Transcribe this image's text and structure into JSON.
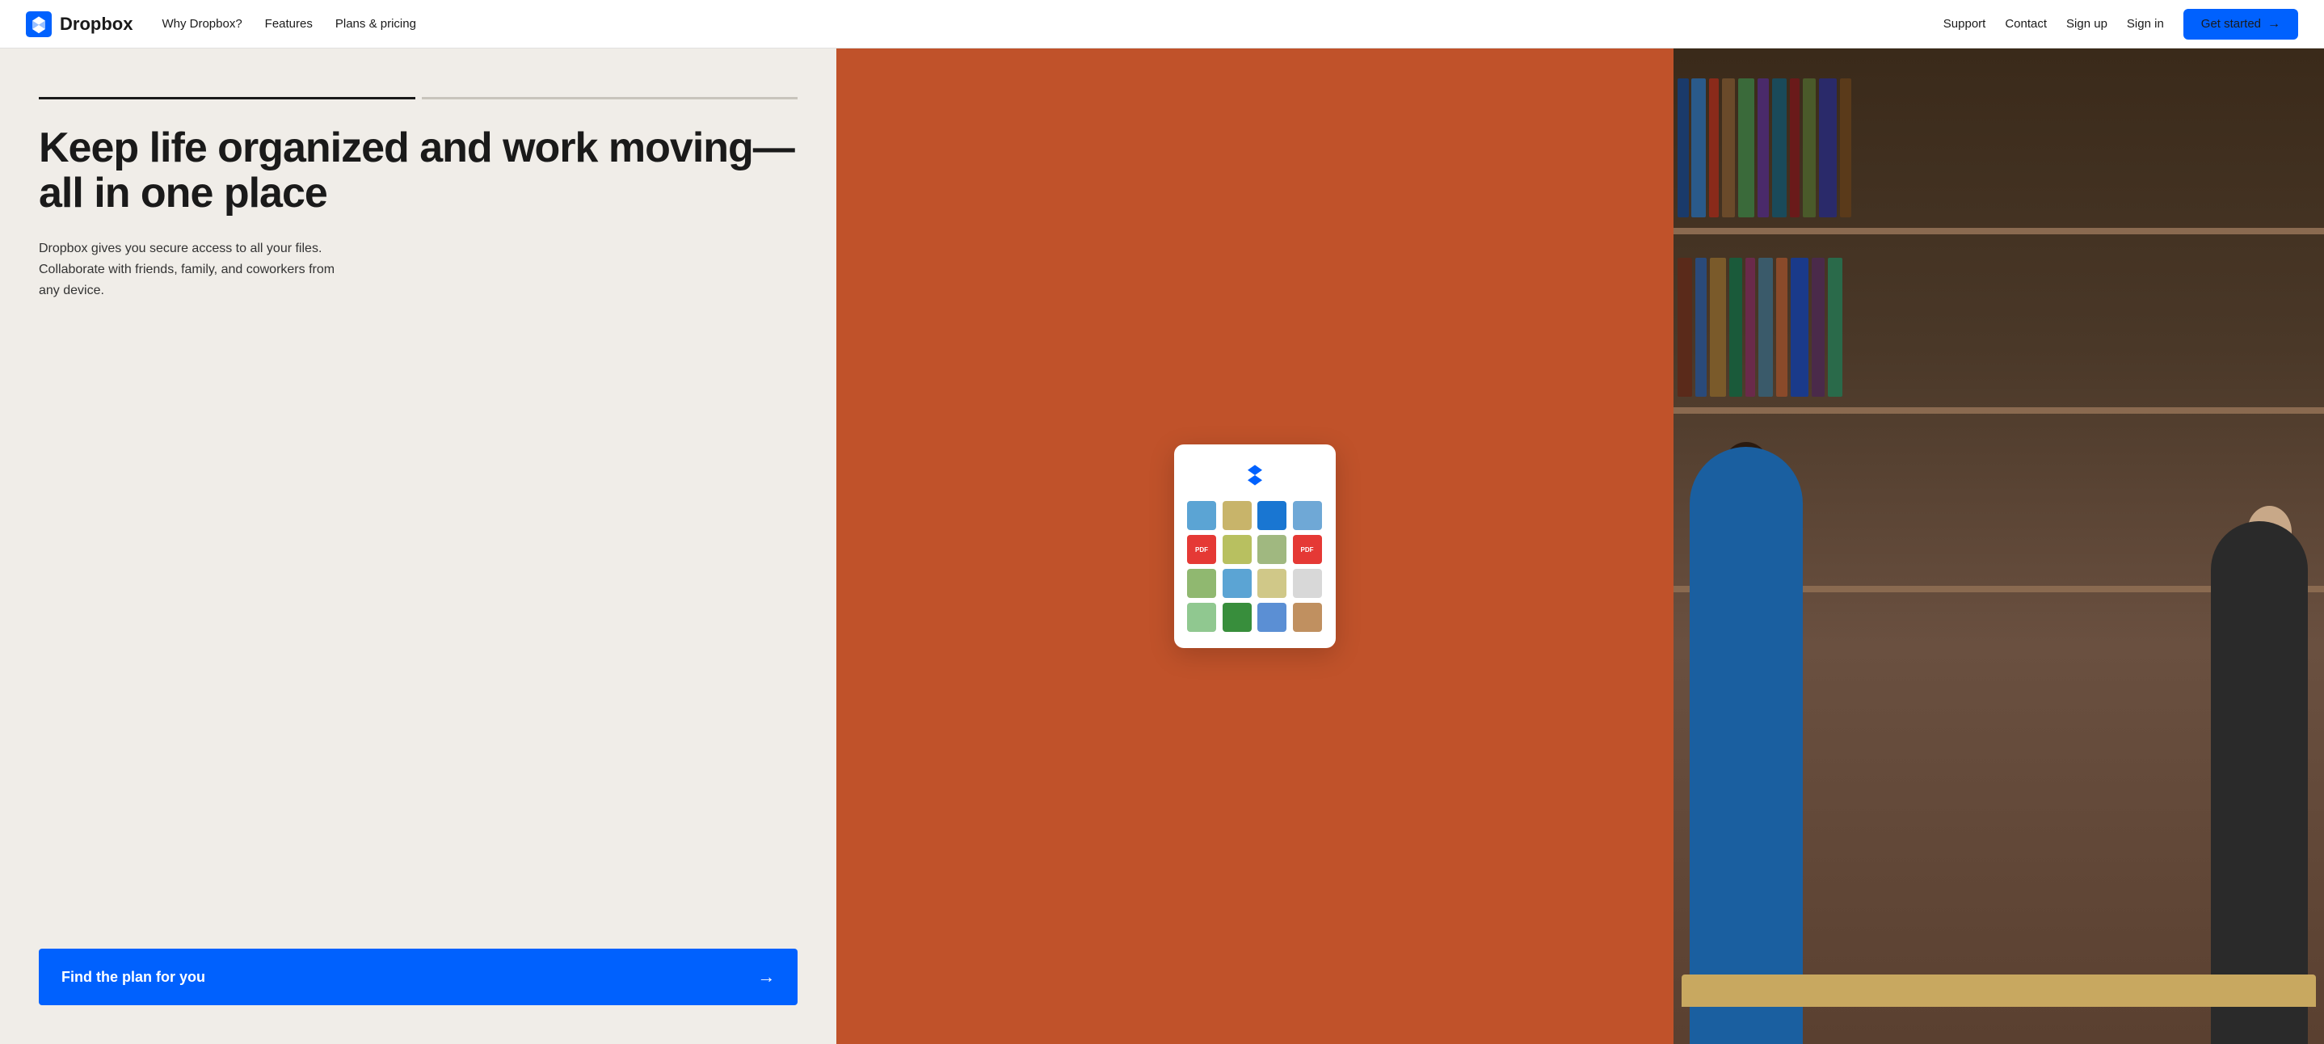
{
  "nav": {
    "logo_text": "Dropbox",
    "links_left": [
      {
        "id": "why-dropbox",
        "label": "Why Dropbox?"
      },
      {
        "id": "features",
        "label": "Features"
      },
      {
        "id": "plans-pricing",
        "label": "Plans & pricing"
      }
    ],
    "links_right": [
      {
        "id": "support",
        "label": "Support"
      },
      {
        "id": "contact",
        "label": "Contact"
      },
      {
        "id": "sign-up",
        "label": "Sign up"
      },
      {
        "id": "sign-in",
        "label": "Sign in"
      }
    ],
    "get_started_label": "Get started",
    "get_started_arrow": "→"
  },
  "hero": {
    "tab_count": 2,
    "headline": "Keep life organized and work moving— all in one place",
    "subtext": "Dropbox gives you secure access to all your files. Collaborate with friends, family, and coworkers from any device.",
    "cta_label": "Find the plan for you",
    "cta_arrow": "→"
  },
  "colors": {
    "brand_blue": "#0061fe",
    "hero_bg": "#f0ede8",
    "center_panel": "#c0522a",
    "nav_bg": "#ffffff"
  }
}
